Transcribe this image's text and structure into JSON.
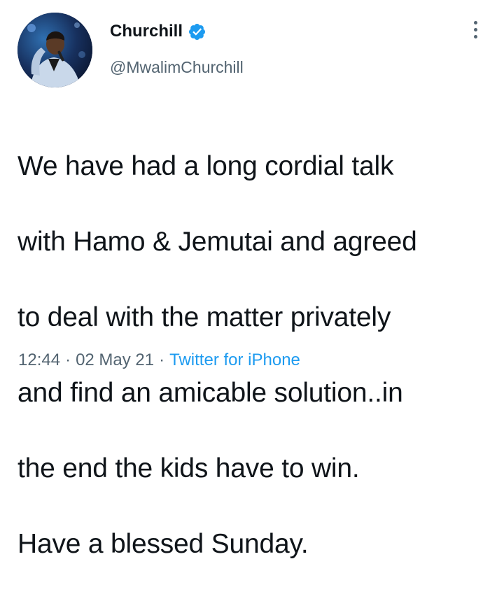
{
  "tweet": {
    "display_name": "Churchill",
    "handle": "@MwalimChurchill",
    "verified_icon": "verified-badge-icon",
    "text_lines": [
      "We have had a long cordial talk",
      "with Hamo & Jemutai and agreed",
      "to deal with the matter privately",
      "and find an amicable solution..in",
      "the end the kids have to win.",
      "Have a blessed Sunday."
    ],
    "time": "12:44",
    "date": "02 May 21",
    "source": "Twitter for iPhone",
    "separator": "·"
  },
  "colors": {
    "text": "#0f1419",
    "secondary": "#536471",
    "accent": "#1d9bf0"
  }
}
